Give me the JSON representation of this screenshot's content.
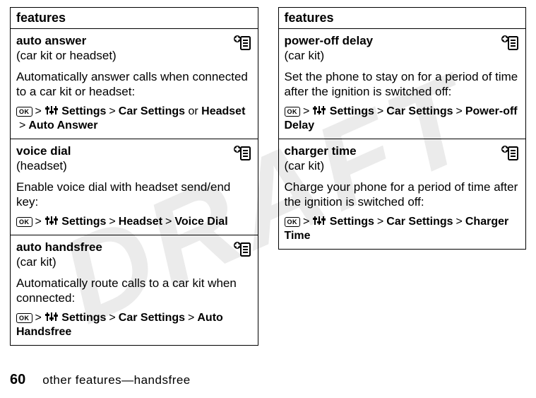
{
  "watermark": "DRAFT",
  "header": "features",
  "left": [
    {
      "title": "auto answer",
      "sub": "(car kit or headset)",
      "desc": "Automatically answer calls when connected to a car kit or headset:",
      "path": {
        "settings": "Settings",
        "rest": [
          "Car Settings",
          "or",
          "Headset"
        ],
        "last": "Auto Answer"
      }
    },
    {
      "title": "voice dial",
      "sub": "(headset)",
      "desc": "Enable voice dial with headset send/end key:",
      "path": {
        "settings": "Settings",
        "rest": [
          "Headset"
        ],
        "last": "Voice Dial"
      }
    },
    {
      "title": "auto handsfree",
      "sub": "(car kit)",
      "desc": "Automatically route calls to a car kit when connected:",
      "path": {
        "settings": "Settings",
        "rest": [
          "Car Settings"
        ],
        "last": "Auto Handsfree"
      }
    }
  ],
  "right": [
    {
      "title": "power-off delay",
      "sub": "(car kit)",
      "desc": "Set the phone to stay on for a period of time after the ignition is switched off:",
      "path": {
        "settings": "Settings",
        "rest": [
          "Car Settings"
        ],
        "last": "Power-off Delay"
      }
    },
    {
      "title": "charger time",
      "sub": "(car kit)",
      "desc": "Charge your phone for a period of time after the ignition is switched off:",
      "path": {
        "settings": "Settings",
        "rest": [
          "Car Settings"
        ],
        "last": "Charger Time"
      }
    }
  ],
  "footer": {
    "page": "60",
    "text": "other features—handsfree"
  }
}
